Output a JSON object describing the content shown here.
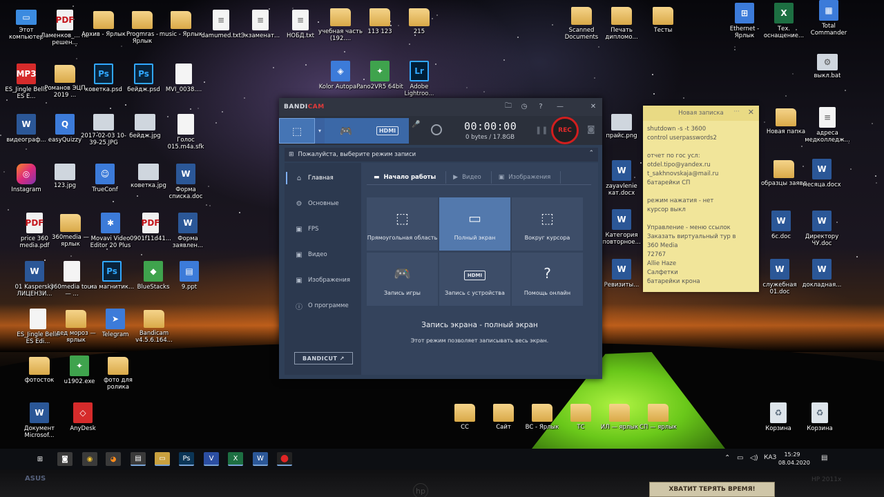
{
  "desktop": {
    "icons": [
      {
        "label": "Этот компьютер",
        "glyph": "▭",
        "type": "pc"
      },
      {
        "label": "Ламенков_... по решен...",
        "glyph": "PDF",
        "type": "pdf"
      },
      {
        "label": "Архив - Ярлык",
        "glyph": "",
        "type": "folder"
      },
      {
        "label": "Progmras - Ярлык",
        "glyph": "",
        "type": "folder"
      },
      {
        "label": "music - Ярлык",
        "glyph": "",
        "type": "folder"
      },
      {
        "label": "damumed.txt",
        "glyph": "≡",
        "type": "doc"
      },
      {
        "label": "Экзаменат...",
        "glyph": "≡",
        "type": "doc"
      },
      {
        "label": "НОБД.txt",
        "glyph": "≡",
        "type": "doc"
      },
      {
        "label": "учебная часть (192....",
        "glyph": "",
        "type": "folder"
      },
      {
        "label": "113 123",
        "glyph": "",
        "type": "folder"
      },
      {
        "label": "215",
        "glyph": "",
        "type": "folder"
      },
      {
        "label": "Scanned Documents",
        "glyph": "",
        "type": "folder"
      },
      {
        "label": "Печать дипломо...",
        "glyph": "",
        "type": "folder"
      },
      {
        "label": "Тесты",
        "glyph": "",
        "type": "folder"
      },
      {
        "label": "Ethernet - Ярлык",
        "glyph": "⊞",
        "type": "app"
      },
      {
        "label": "Тех. оснащение...",
        "glyph": "X",
        "type": "excel"
      },
      {
        "label": "Total Commander",
        "glyph": "▦",
        "type": "app"
      },
      {
        "label": "ES_Jingle Bells ES E...",
        "glyph": "MP3",
        "type": "red"
      },
      {
        "label": "Романов ЭЦП 2019 ...",
        "glyph": "",
        "type": "folder"
      },
      {
        "label": "коветка.psd",
        "glyph": "Ps",
        "type": "ps"
      },
      {
        "label": "бейдж.psd",
        "glyph": "Ps",
        "type": "ps"
      },
      {
        "label": "MVI_0038....",
        "glyph": "",
        "type": "doc"
      },
      {
        "label": "Kolor Autopa...",
        "glyph": "◈",
        "type": "app"
      },
      {
        "label": "Pano2VR5 64bit",
        "glyph": "✦",
        "type": "green"
      },
      {
        "label": "Adobe Lightroo...",
        "glyph": "Lr",
        "type": "lr"
      },
      {
        "label": "выкл.bat",
        "glyph": "⚙",
        "type": "img"
      },
      {
        "label": "видеограф...",
        "glyph": "W",
        "type": "word"
      },
      {
        "label": "easyQuizzy",
        "glyph": "Q",
        "type": "app"
      },
      {
        "label": "2017-02-03 10-39-25.JPG",
        "glyph": "",
        "type": "img"
      },
      {
        "label": "бейдж.jpg",
        "glyph": "",
        "type": "img"
      },
      {
        "label": "Голос 015.m4a.sfk",
        "glyph": "",
        "type": "doc"
      },
      {
        "label": "прайс.png",
        "glyph": "",
        "type": "img"
      },
      {
        "label": "Новая папка",
        "glyph": "",
        "type": "folder"
      },
      {
        "label": "адреса медколледж...",
        "glyph": "≡",
        "type": "doc"
      },
      {
        "label": "Instagram",
        "glyph": "◎",
        "type": "pink"
      },
      {
        "label": "123.jpg",
        "glyph": "",
        "type": "img"
      },
      {
        "label": "TrueConf",
        "glyph": "☺",
        "type": "app"
      },
      {
        "label": "коветка.jpg",
        "glyph": "",
        "type": "img"
      },
      {
        "label": "Форма списка.doc",
        "glyph": "W",
        "type": "word"
      },
      {
        "label": "zayavlenie кат.docx",
        "glyph": "W",
        "type": "word"
      },
      {
        "label": "образцы заявл",
        "glyph": "",
        "type": "folder"
      },
      {
        "label": "месяца.docx",
        "glyph": "W",
        "type": "word"
      },
      {
        "label": "price 360 media.pdf",
        "glyph": "PDF",
        "type": "pdf"
      },
      {
        "label": "360media — ярлык",
        "glyph": "",
        "type": "folder"
      },
      {
        "label": "Movavi Video Editor 20 Plus",
        "glyph": "✱",
        "type": "app"
      },
      {
        "label": "0901f11d41...",
        "glyph": "PDF",
        "type": "pdf"
      },
      {
        "label": "Форма заявлен...",
        "glyph": "W",
        "type": "word"
      },
      {
        "label": "Категория повторное...",
        "glyph": "W",
        "type": "word"
      },
      {
        "label": "6с.doc",
        "glyph": "W",
        "type": "word"
      },
      {
        "label": "Директору ЧУ.doc",
        "glyph": "W",
        "type": "word"
      },
      {
        "label": "01 Kaspersky ЛИЦЕНЗИ...",
        "glyph": "W",
        "type": "word"
      },
      {
        "label": "360media tour — ...",
        "glyph": "",
        "type": "doc"
      },
      {
        "label": "на магнитик...",
        "glyph": "Ps",
        "type": "ps"
      },
      {
        "label": "BlueStacks",
        "glyph": "◆",
        "type": "green"
      },
      {
        "label": "9.ppt",
        "glyph": "▤",
        "type": "app"
      },
      {
        "label": "Ревизиты...",
        "glyph": "W",
        "type": "word"
      },
      {
        "label": "служебная 01.doc",
        "glyph": "W",
        "type": "word"
      },
      {
        "label": "докладная...",
        "glyph": "W",
        "type": "word"
      },
      {
        "label": "ES_Jingle Bells ES Edi...",
        "glyph": "",
        "type": "doc"
      },
      {
        "label": "дед мороз — ярлык",
        "glyph": "",
        "type": "folder"
      },
      {
        "label": "Telegram",
        "glyph": "➤",
        "type": "app"
      },
      {
        "label": "Bandicam v4.5.6.164...",
        "glyph": "",
        "type": "folder"
      },
      {
        "label": "фотосток",
        "glyph": "",
        "type": "folder"
      },
      {
        "label": "u1902.exe",
        "glyph": "✦",
        "type": "green"
      },
      {
        "label": "фото для ролика",
        "glyph": "",
        "type": "folder"
      },
      {
        "label": "Документ Microsof...",
        "glyph": "W",
        "type": "word"
      },
      {
        "label": "AnyDesk",
        "glyph": "◇",
        "type": "red"
      },
      {
        "label": "СС",
        "glyph": "",
        "type": "folder"
      },
      {
        "label": "Сайт",
        "glyph": "",
        "type": "folder"
      },
      {
        "label": "ВС - Ярлык",
        "glyph": "",
        "type": "folder"
      },
      {
        "label": "ТС",
        "glyph": "",
        "type": "folder"
      },
      {
        "label": "ИЛ — ярлык",
        "glyph": "",
        "type": "folder"
      },
      {
        "label": "СП — ярлык",
        "glyph": "",
        "type": "folder"
      },
      {
        "label": "Корзина",
        "glyph": "♻",
        "type": "bin"
      },
      {
        "label": "Корзина",
        "glyph": "♻",
        "type": "bin"
      }
    ]
  },
  "sticky_note": {
    "title": "Новая записка",
    "dots": "···",
    "close": "✕",
    "lines": [
      "shutdown -s -t 3600",
      "control userpasswords2",
      "",
      "отчет по гос усл:",
      "otdel.tipo@yandex.ru",
      "t_sakhnovskaja@mail.ru",
      "батарейки СП",
      "",
      "режим нажатия - нет",
      "курсор выкл",
      "",
      "Управление - меню ссылок",
      "Заказать виртуальный тур в",
      "360 Media",
      "72767",
      "Allie Haze",
      "Салфетки",
      "батарейки крона"
    ]
  },
  "bandicam": {
    "logo_main": "BANDI",
    "logo_cam": "CAM",
    "title_icons": {
      "folder": "🗀",
      "clock": "◷",
      "help": "?",
      "minimize": "—",
      "close": "✕"
    },
    "toolbar": {
      "mode_screen_icon": "⬚",
      "mode_dropdown": "▾",
      "mode_game_icon": "🎮",
      "mode_hdmi_label": "HDMI",
      "timer": "00:00:00",
      "size": "0 bytes / 17.8GB",
      "pause_icon": "❚❚",
      "rec_label": "REC",
      "camera_icon": "◙",
      "mic_icon": "🎤"
    },
    "subheader": {
      "icon": "⊞",
      "text": "Пожалуйста, выберите режим записи",
      "collapse": "⌃"
    },
    "sidebar": {
      "items": [
        {
          "label": "Главная",
          "icon": "⌂"
        },
        {
          "label": "Основные",
          "icon": "⚙"
        },
        {
          "label": "FPS",
          "icon": "▣"
        },
        {
          "label": "Видео",
          "icon": "▣"
        },
        {
          "label": "Изображения",
          "icon": "▣"
        },
        {
          "label": "О программе",
          "icon": "ⓘ"
        }
      ],
      "bandicut": "BANDICUT ↗"
    },
    "tabs": [
      {
        "label": "Начало работы",
        "icon": "▬"
      },
      {
        "label": "Видео",
        "icon": "▶"
      },
      {
        "label": "Изображения",
        "icon": "▣"
      }
    ],
    "modes": [
      {
        "label": "Прямоугольная область",
        "icon": "⬚"
      },
      {
        "label": "Полный экран",
        "icon": "▭"
      },
      {
        "label": "Вокруг курсора",
        "icon": "⬚"
      },
      {
        "label": "Запись игры",
        "icon": "🎮"
      },
      {
        "label": "Запись с устройства",
        "icon": "HDMI"
      },
      {
        "label": "Помощь онлайн",
        "icon": "?"
      }
    ],
    "description_title": "Запись экрана - полный экран",
    "description_text": "Этот режим позволяет записывать весь экран."
  },
  "taskbar": {
    "start": "⊞",
    "apps": [
      {
        "name": "camera",
        "glyph": "◙"
      },
      {
        "name": "chrome",
        "glyph": "◉"
      },
      {
        "name": "firefox",
        "glyph": "◕"
      },
      {
        "name": "app",
        "glyph": "▤"
      },
      {
        "name": "explorer",
        "glyph": "▭"
      },
      {
        "name": "photoshop",
        "glyph": "Ps"
      },
      {
        "name": "visio",
        "glyph": "V"
      },
      {
        "name": "excel",
        "glyph": "X"
      },
      {
        "name": "word",
        "glyph": "W"
      },
      {
        "name": "bandicam",
        "glyph": "●"
      }
    ],
    "tray": {
      "chevron": "⌃",
      "network": "▭",
      "volume": "◁)",
      "lang": "КАЗ",
      "notify": "▤"
    },
    "time": "15:29",
    "date": "08.04.2020"
  },
  "bezel": {
    "asus": "ASUS",
    "brand": "hp",
    "model": "HP 2011x",
    "sticker": "ХВАТИТ ТЕРЯТЬ ВРЕМЯ!"
  }
}
